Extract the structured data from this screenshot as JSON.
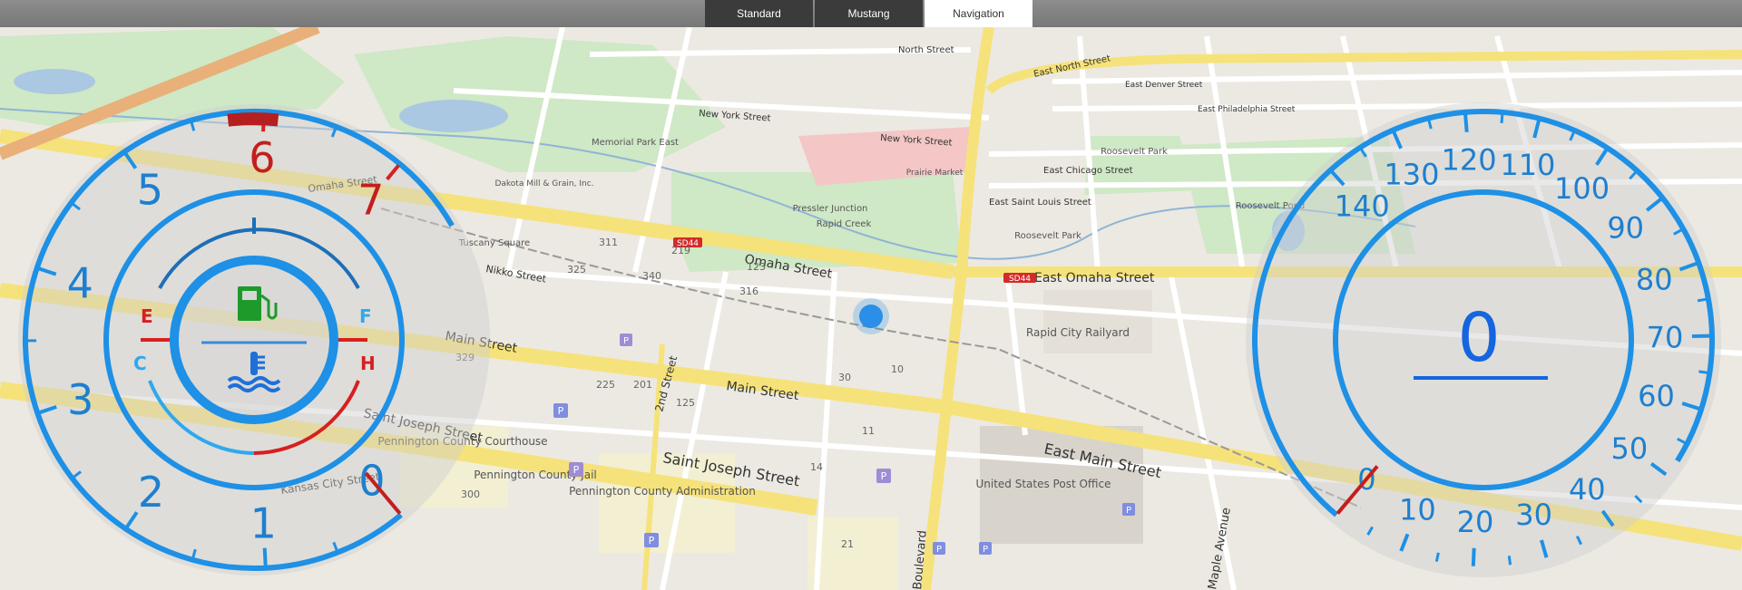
{
  "tabs": [
    {
      "label": "Standard",
      "active": false
    },
    {
      "label": "Mustang",
      "active": false
    },
    {
      "label": "Navigation",
      "active": true
    }
  ],
  "map": {
    "streets": {
      "omaha_street": "Omaha Street",
      "east_omaha_street": "East Omaha Street",
      "main_street_left": "Main Street",
      "main_street_center": "Main Street",
      "east_main_street": "East Main Street",
      "saint_joseph_street_left": "Saint Joseph Street",
      "saint_joseph_street_center": "Saint Joseph Street",
      "kansas_city_street": "Kansas City Street",
      "second_street": "2nd Street",
      "nikko_street": "Nikko Street",
      "new_york_street": "New York Street",
      "new_york_street_2": "New York Street",
      "north_street": "North Street",
      "east_north_street": "East North Street",
      "east_chicago_street": "East Chicago Street",
      "east_saint_louis_street": "East Saint Louis Street",
      "east_denver_street": "East Denver Street",
      "east_philadelphia_street": "East Philadelphia Street",
      "boulevard": "Boulevard",
      "maple_avenue": "Maple Avenue",
      "omaha_street_top": "Omaha Street"
    },
    "places": {
      "pennington_courthouse": "Pennington County Courthouse",
      "pennington_jail": "Pennington County Jail",
      "pennington_admin": "Pennington County Administration",
      "post_office": "United States Post Office",
      "rapid_city_railyard": "Rapid City Railyard",
      "pressler_junction": "Pressler Junction",
      "rapid_creek": "Rapid Creek",
      "roosevelt_park": "Roosevelt Park",
      "roosevelt_park_2": "Roosevelt Park",
      "roosevelt_pond": "Roosevelt Pond",
      "memorial_park_east": "Memorial Park East",
      "prairie_market": "Prairie Market",
      "tuscany_square": "Tuscany Square",
      "dakota_mill": "Dakota Mill & Grain, Inc."
    },
    "shields": {
      "sd44_a": "SD44",
      "sd44_b": "SD44"
    },
    "numbers": {
      "n_125": "125",
      "n_225": "225",
      "n_201": "201",
      "n_14": "14",
      "n_11": "11",
      "n_30": "30",
      "n_10": "10",
      "n_21": "21",
      "n_300": "300",
      "n_329": "329",
      "n_340": "340",
      "n_316": "316",
      "n_123": "123",
      "n_311": "311",
      "n_325": "325",
      "n_219": "219"
    }
  },
  "fuel_temp_gauge": {
    "rpm_ticks": [
      "0",
      "1",
      "2",
      "3",
      "4",
      "5",
      "6",
      "7"
    ],
    "fuel_empty": "E",
    "fuel_full": "F",
    "temp_cold": "C",
    "temp_hot": "H",
    "icons": [
      "fuel-pump-icon",
      "coolant-temperature-icon"
    ],
    "rpm_value": 0,
    "colors": {
      "blue": "#1e90e6",
      "red": "#d62020",
      "icon_green": "#1e9a2a"
    }
  },
  "speedometer": {
    "speed_value": "0",
    "ticks": [
      "0",
      "10",
      "20",
      "30",
      "40",
      "50",
      "60",
      "70",
      "80",
      "90",
      "100",
      "110",
      "120",
      "130",
      "140"
    ],
    "colors": {
      "blue": "#1e90e6",
      "digital": "#1565e0",
      "red": "#d62020"
    }
  }
}
